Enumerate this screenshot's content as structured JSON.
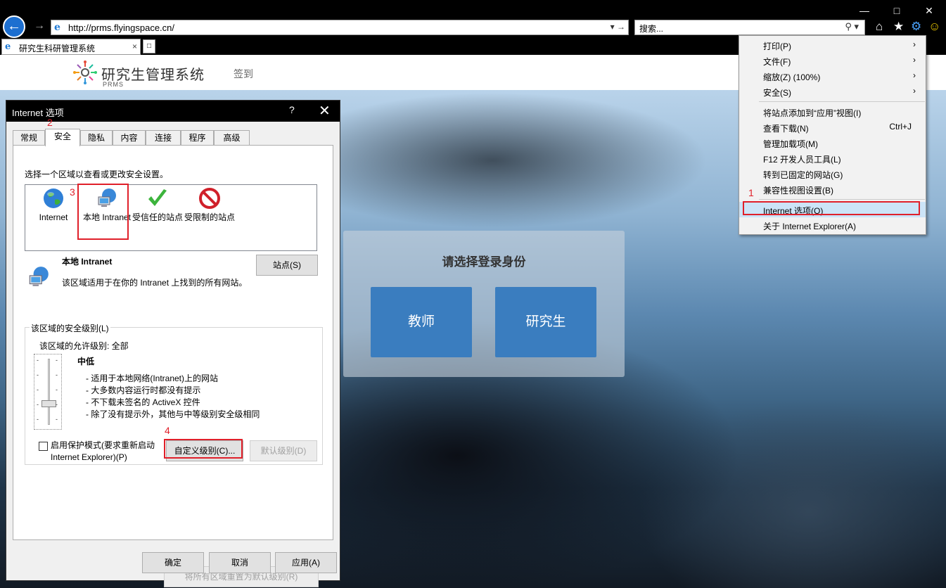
{
  "browser": {
    "url": "http://prms.flyingspace.cn/",
    "search_placeholder": "搜索...",
    "tab_title": "研究生科研管理系统",
    "tab_close": "×"
  },
  "site": {
    "title": "研究生管理系统",
    "subtitle": "PRMS",
    "signin": "签到"
  },
  "login": {
    "title": "请选择登录身份",
    "roles": [
      "教师",
      "研究生"
    ]
  },
  "menu": {
    "items": [
      {
        "label": "打印(P)",
        "right": "›"
      },
      {
        "label": "文件(F)",
        "right": "›"
      },
      {
        "label": "缩放(Z) (100%)",
        "right": "›"
      },
      {
        "label": "安全(S)",
        "right": "›"
      },
      {
        "label": "将站点添加到“应用”视图(I)",
        "right": ""
      },
      {
        "label": "查看下载(N)",
        "right": "Ctrl+J"
      },
      {
        "label": "管理加载项(M)",
        "right": ""
      },
      {
        "label": "F12 开发人员工具(L)",
        "right": ""
      },
      {
        "label": "转到已固定的网站(G)",
        "right": ""
      },
      {
        "label": "兼容性视图设置(B)",
        "right": ""
      },
      {
        "label": "Internet 选项(O)",
        "right": "",
        "highlighted": true
      },
      {
        "label": "关于 Internet Explorer(A)",
        "right": ""
      }
    ]
  },
  "annotations": {
    "step1": "1",
    "step2": "2",
    "step3": "3",
    "step4": "4"
  },
  "dialog": {
    "title": "Internet 选项",
    "help": "?",
    "close": "✕",
    "tabs": [
      "常规",
      "安全",
      "隐私",
      "内容",
      "连接",
      "程序",
      "高级"
    ],
    "active_tab": "安全",
    "zone_prompt": "选择一个区域以查看或更改安全设置。",
    "zones": [
      {
        "label": "Internet",
        "icon": "globe-icon"
      },
      {
        "label": "本地 Intranet",
        "icon": "intranet-icon",
        "selected": true
      },
      {
        "label": "受信任的站点",
        "icon": "checkmark-icon"
      },
      {
        "label": "受限制的站点",
        "icon": "restricted-icon"
      }
    ],
    "selected_zone_name": "本地 Intranet",
    "selected_zone_desc": "该区域适用于在你的 Intranet 上找到的所有网站。",
    "sites_button": "站点(S)",
    "security_level_legend": "该区域的安全级别(L)",
    "allowed_levels": "该区域的允许级别: 全部",
    "level_name": "中低",
    "level_bullets": [
      "- 适用于本地网络(Intranet)上的网站",
      "- 大多数内容运行时都没有提示",
      "- 不下载未签名的 ActiveX 控件",
      "- 除了没有提示外，其他与中等级别安全级相同"
    ],
    "protected_mode_label_1": "启用保护模式(要求重新启动",
    "protected_mode_label_2": "Internet Explorer)(P)",
    "custom_level_button": "自定义级别(C)...",
    "default_level_button": "默认级别(D)",
    "reset_all_button": "将所有区域重置为默认级别(R)",
    "ok_button": "确定",
    "cancel_button": "取消",
    "apply_button": "应用(A)"
  },
  "colors": {
    "accent": "#3a7dbf",
    "annotation_red": "#e0202a",
    "menu_highlight": "#cce4f7"
  }
}
